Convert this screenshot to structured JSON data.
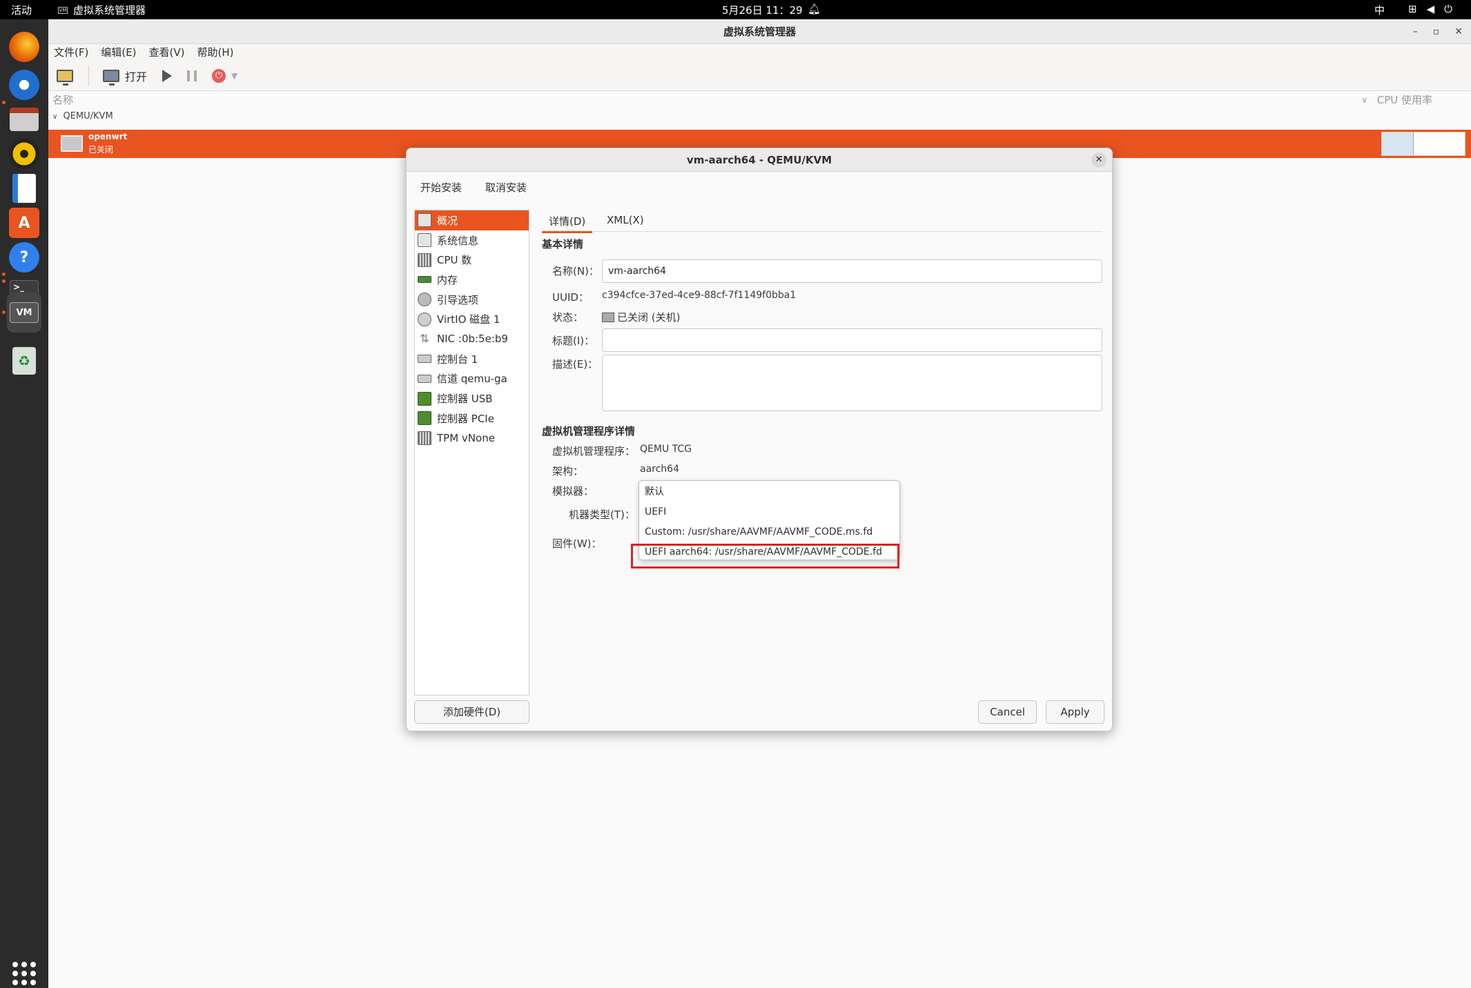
{
  "topbar": {
    "activities": "活动",
    "app_name": "虚拟系统管理器",
    "app_icon_text": "VM",
    "clock": "5月26日  11：29",
    "input_method": "中"
  },
  "dock": {
    "items": [
      {
        "name": "firefox",
        "color": "#e66000"
      },
      {
        "name": "thunderbird",
        "color": "#1f6fd1"
      },
      {
        "name": "files",
        "color": "#b53a20"
      },
      {
        "name": "rhythmbox",
        "color": "#f0c000"
      },
      {
        "name": "libreoffice-writer",
        "color": "#2d7cd8"
      },
      {
        "name": "software-center",
        "color": "#e95420"
      },
      {
        "name": "help",
        "color": "#2f80ed"
      },
      {
        "name": "terminal",
        "color": "#3c3c3c"
      },
      {
        "name": "virt-manager",
        "color": "#555555"
      },
      {
        "name": "trash",
        "color": "#7a9a7a"
      }
    ]
  },
  "main_window": {
    "title": "虚拟系统管理器",
    "menu": [
      "文件(F)",
      "编辑(E)",
      "查看(V)",
      "帮助(H)"
    ],
    "toolbar": {
      "open_label": "打开"
    },
    "list_header": {
      "name_col": "名称",
      "cpu_col": "CPU 使用率"
    },
    "group": "QEMU/KVM",
    "vm": {
      "name": "openwrt",
      "state": "已关闭"
    }
  },
  "dialog": {
    "title": "vm-aarch64 - QEMU/KVM",
    "begin_install": "开始安装",
    "cancel_install": "取消安装",
    "hardware_list": [
      {
        "label": "概况",
        "icon": "monitor-icon",
        "selected": true
      },
      {
        "label": "系统信息",
        "icon": "monitor-icon",
        "selected": false
      },
      {
        "label": "CPU 数",
        "icon": "cpu-icon",
        "selected": false
      },
      {
        "label": "内存",
        "icon": "memory-icon",
        "selected": false
      },
      {
        "label": "引导选项",
        "icon": "gear-icon",
        "selected": false
      },
      {
        "label": "VirtIO 磁盘 1",
        "icon": "disk-icon",
        "selected": false
      },
      {
        "label": "NIC :0b:5e:b9",
        "icon": "network-icon",
        "selected": false
      },
      {
        "label": "控制台 1",
        "icon": "console-icon",
        "selected": false
      },
      {
        "label": "信道 qemu-ga",
        "icon": "channel-icon",
        "selected": false
      },
      {
        "label": "控制器 USB",
        "icon": "controller-icon",
        "selected": false
      },
      {
        "label": "控制器 PCIe",
        "icon": "controller-icon",
        "selected": false
      },
      {
        "label": "TPM vNone",
        "icon": "cpu-icon",
        "selected": false
      }
    ],
    "add_hardware": "添加硬件(D)",
    "tabs": {
      "details": "详情(D)",
      "xml": "XML(X)"
    },
    "basic": {
      "heading": "基本详情",
      "name_label": "名称(N)：",
      "name_value": "vm-aarch64",
      "uuid_label": "UUID：",
      "uuid_value": "c394cfce-37ed-4ce9-88cf-7f1149f0bba1",
      "state_label": "状态：",
      "state_value": "已关闭 (关机)",
      "title_label": "标题(I)：",
      "title_value": "",
      "desc_label": "描述(E)：",
      "desc_value": ""
    },
    "hypervisor": {
      "heading": "虚拟机管理程序详情",
      "hv_label": "虚拟机管理程序：",
      "hv_value": "QEMU TCG",
      "arch_label": "架构：",
      "arch_value": "aarch64",
      "emulator_label": "模拟器：",
      "machine_label": "机器类型(T)：",
      "firmware_label": "固件(W)："
    },
    "firmware_options": [
      "默认",
      "UEFI",
      "Custom: /usr/share/AAVMF/AAVMF_CODE.ms.fd",
      "UEFI aarch64: /usr/share/AAVMF/AAVMF_CODE.fd"
    ],
    "cancel": "Cancel",
    "apply": "Apply"
  },
  "colors": {
    "accent": "#e95420",
    "highlight_box": "#e21d1d"
  }
}
